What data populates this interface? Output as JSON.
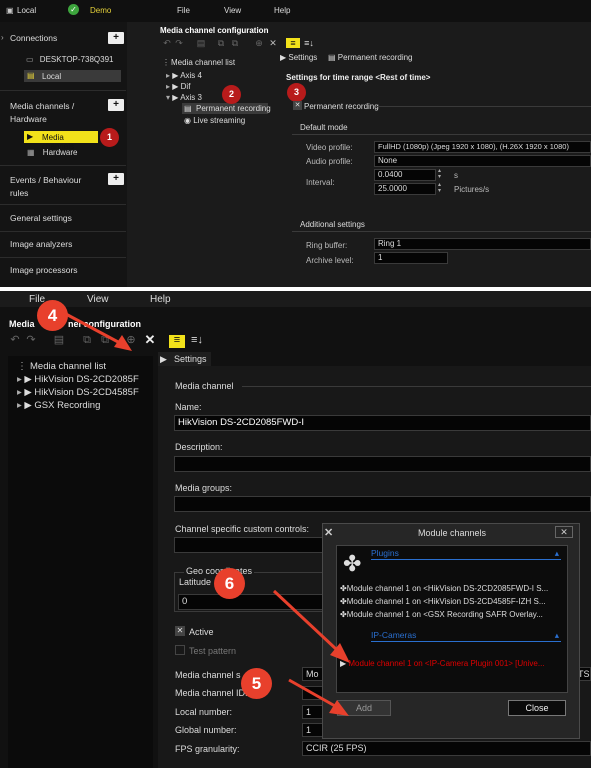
{
  "top": {
    "menubar": {
      "connection": "Local",
      "server": "Demo",
      "menu": [
        "File",
        "View",
        "Help"
      ]
    },
    "sidebar": {
      "connections_label": "Connections",
      "connections": [
        "DESKTOP-738Q391",
        "Local"
      ],
      "media_label": "Media channels / Hardware",
      "media_items": [
        "Media channels",
        "Hardware"
      ],
      "events_label": "Events / Behaviour rules",
      "general_label": "General settings",
      "analyzers_label": "Image analyzers",
      "processors_label": "Image processors"
    },
    "panel_title": "Media channel configuration",
    "tree": {
      "header": "Media channel list",
      "items": [
        "Axis 4",
        "Dif",
        "Axis 3",
        "Permanent recording",
        "Live streaming"
      ]
    },
    "tabs": [
      "Settings",
      "Permanent recording"
    ],
    "settings_heading": "Settings for time range <Rest of time>",
    "permanent_recording": "Permanent recording",
    "default_mode": "Default mode",
    "video_profile_label": "Video profile:",
    "video_profile_value": "FullHD (1080p) (Jpeg 1920 x 1080), (H.26X 1920 x 1080)",
    "audio_profile_label": "Audio profile:",
    "audio_profile_value": "None",
    "interval_label": "Interval:",
    "interval_value": "0.0400",
    "interval_unit": "s",
    "fps_value": "25.0000",
    "fps_unit": "Pictures/s",
    "additional_settings": "Additional settings",
    "ring_buffer_label": "Ring buffer:",
    "ring_buffer_value": "Ring 1",
    "archive_level_label": "Archive level:",
    "archive_level_value": "1",
    "badges": [
      "1",
      "2",
      "3"
    ]
  },
  "bottom": {
    "menu": [
      "File",
      "View",
      "Help"
    ],
    "panel_title_left": "Media",
    "panel_title_right": "nel configuration",
    "tree": {
      "header": "Media channel list",
      "items": [
        "HikVision DS-2CD2085F",
        "HikVision DS-2CD4585F",
        "GSX Recording"
      ]
    },
    "settings_tab": "Settings",
    "media_channel": "Media channel",
    "name_label": "Name:",
    "name_value": "HikVision DS-2CD2085FWD-I",
    "description_label": "Description:",
    "media_groups_label": "Media groups:",
    "custom_controls_label": "Channel specific custom controls:",
    "geo_label": "Geo coordinates",
    "latitude_label": "Latitude",
    "latitude_value": "0",
    "active_label": "Active",
    "test_pattern_label": "Test pattern",
    "media_channel_s_label": "Media channel s",
    "media_channel_s_value": "Mo",
    "media_channel_s_suffix": "TS",
    "media_channel_id_label": "Media channel ID:",
    "local_number_label": "Local number:",
    "local_number_value": "1",
    "global_number_label": "Global number:",
    "global_number_value": "1",
    "fps_granularity_label": "FPS granularity:",
    "fps_granularity_value": "CCIR (25 FPS)",
    "dialog": {
      "title": "Module channels",
      "plugins_header": "Plugins",
      "plugins": [
        "Module channel 1 on <HikVision DS-2CD2085FWD-I S...",
        "Module channel 1 on <HikVision DS-2CD4585F-IZH S...",
        "Module channel 1 on <GSX Recording SAFR Overlay..."
      ],
      "ipcam_header": "IP-Cameras",
      "ipcam_items": [
        "Module channel 1 on <IP-Camera Plugin 001> [Unive..."
      ],
      "add_button": "Add",
      "close_button": "Close"
    },
    "badges": [
      "4",
      "5",
      "6"
    ],
    "colors": {
      "annotation": "#e8402c",
      "highlight": "#e00000",
      "header_blue": "#2a6fcf"
    }
  }
}
